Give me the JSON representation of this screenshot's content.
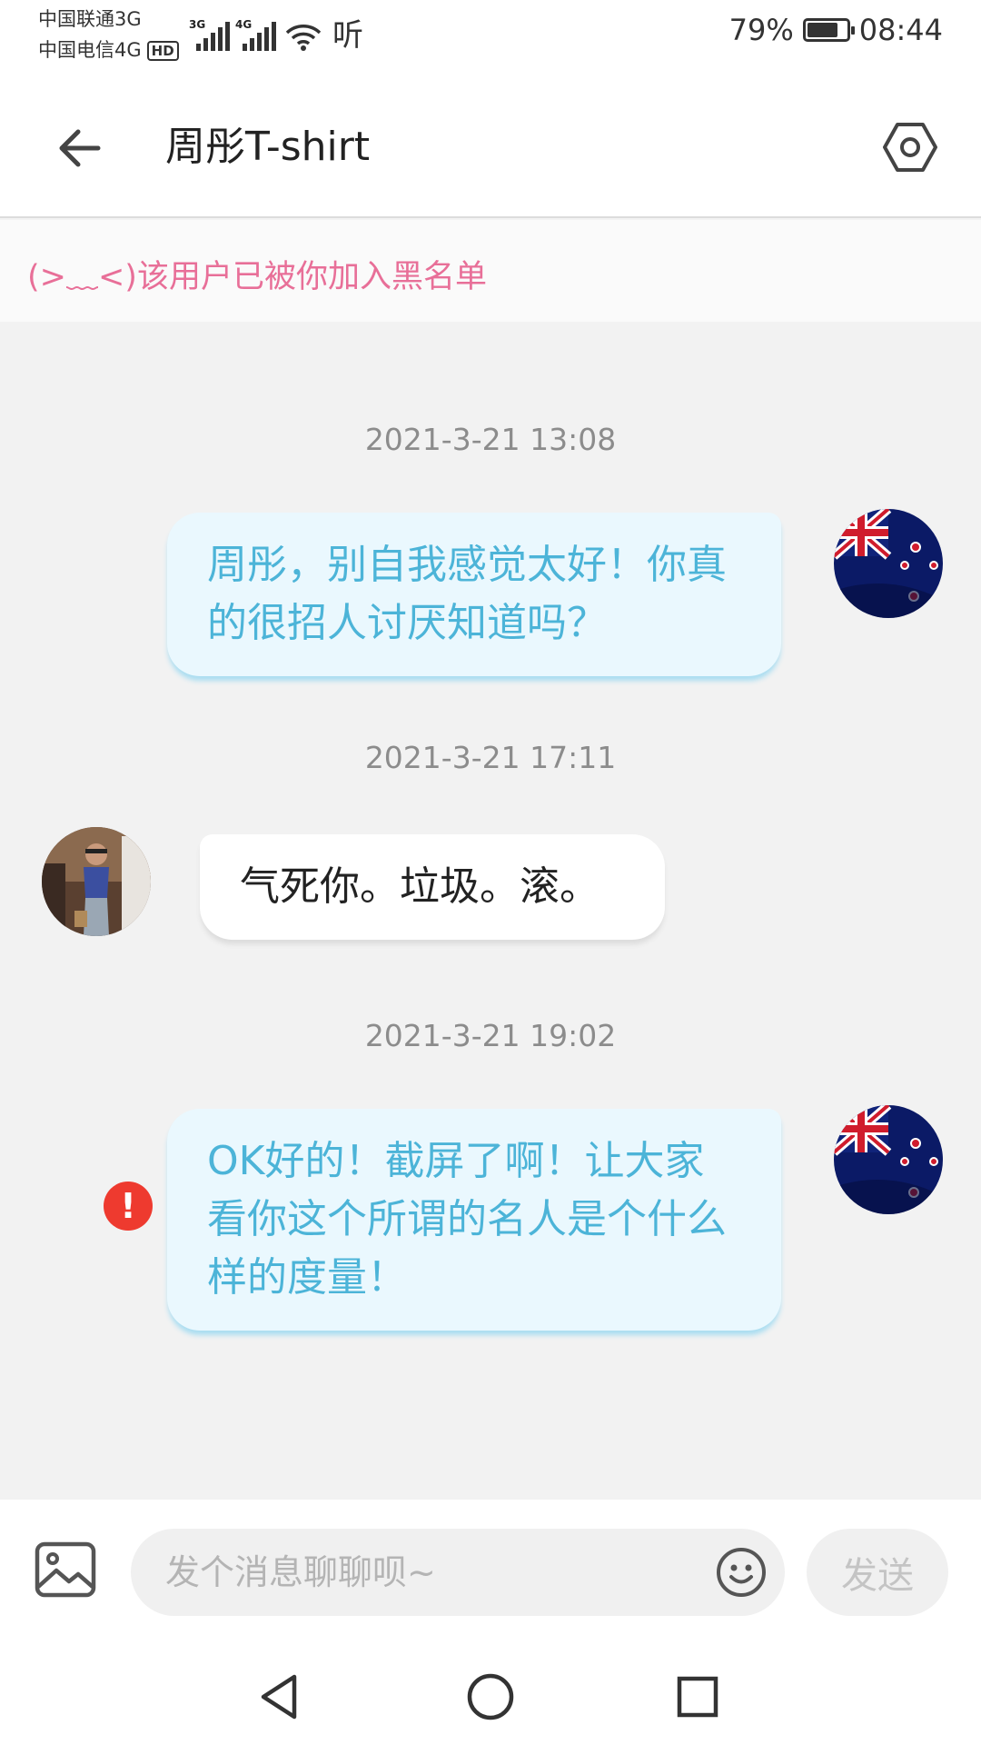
{
  "status_bar": {
    "carrier_1": "中国联通3G",
    "carrier_2": "中国电信4G",
    "hd_badge": "HD",
    "net_1": "3G",
    "net_2": "4G",
    "listen_label": "听",
    "battery_percent": "79%",
    "battery_level": 0.79,
    "time": "08:44"
  },
  "header": {
    "title": "周彤T-shirt",
    "back_icon": "arrow-left-icon",
    "settings_icon": "hexagon-settings-icon"
  },
  "notice": {
    "text": "(>﹏<)该用户已被你加入黑名单"
  },
  "messages": [
    {
      "timestamp": "2021-3-21 13:08",
      "sender": "me",
      "text": "周彤，别自我感觉太好！你真的很招人讨厌知道吗？",
      "avatar": "new-zealand-flag-avatar"
    },
    {
      "timestamp": "2021-3-21 17:11",
      "sender": "other",
      "text": "气死你。垃圾。滚。",
      "avatar": "user-photo-avatar"
    },
    {
      "timestamp": "2021-3-21 19:02",
      "sender": "me",
      "text": "OK好的！截屏了啊！让大家看你这个所谓的名人是个什么样的度量！",
      "avatar": "new-zealand-flag-avatar",
      "status": "failed"
    }
  ],
  "input_bar": {
    "placeholder": "发个消息聊聊呗~",
    "value": "",
    "send_label": "发送",
    "image_icon": "image-icon",
    "emoji_icon": "smiley-icon"
  },
  "nav_bar": {
    "icons": [
      "back-triangle-icon",
      "home-circle-icon",
      "recents-square-icon"
    ]
  },
  "colors": {
    "my_bubble_bg": "#eaf8fe",
    "my_bubble_text": "#4cb4d8",
    "notice_text": "#e86f98",
    "error": "#ee3a2f"
  }
}
